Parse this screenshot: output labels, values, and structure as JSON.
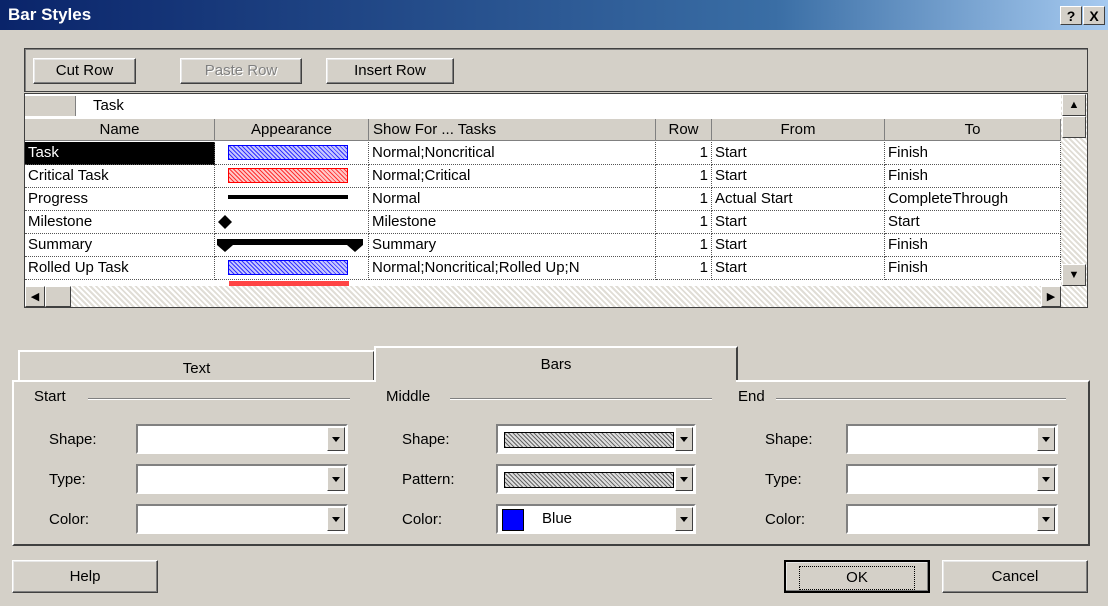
{
  "window": {
    "title": "Bar Styles",
    "help_btn": "?",
    "close_btn": "X"
  },
  "toolbar": {
    "cut_row": "Cut Row",
    "paste_row": "Paste Row",
    "insert_row": "Insert Row"
  },
  "grid": {
    "edit_value": "Task",
    "headers": [
      "Name",
      "Appearance",
      "Show For ... Tasks",
      "Row",
      "From",
      "To"
    ],
    "rows": [
      {
        "name": "Task",
        "appearance": "bar-blue",
        "show_for": "Normal;Noncritical",
        "row": "1",
        "from": "Start",
        "to": "Finish"
      },
      {
        "name": "Critical Task",
        "appearance": "bar-red",
        "show_for": "Normal;Critical",
        "row": "1",
        "from": "Start",
        "to": "Finish"
      },
      {
        "name": "Progress",
        "appearance": "thin-black-line",
        "show_for": "Normal",
        "row": "1",
        "from": "Actual Start",
        "to": "CompleteThrough"
      },
      {
        "name": "Milestone",
        "appearance": "diamond",
        "show_for": "Milestone",
        "row": "1",
        "from": "Start",
        "to": "Start"
      },
      {
        "name": "Summary",
        "appearance": "summary-bracket",
        "show_for": "Summary",
        "row": "1",
        "from": "Start",
        "to": "Finish"
      },
      {
        "name": "Rolled Up Task",
        "appearance": "bar-blue",
        "show_for": "Normal;Noncritical;Rolled Up;N",
        "row": "1",
        "from": "Start",
        "to": "Finish"
      }
    ]
  },
  "tabs": {
    "text": "Text",
    "bars": "Bars",
    "active": "Bars"
  },
  "groups": {
    "start": {
      "label": "Start",
      "shape_label": "Shape:",
      "type_label": "Type:",
      "color_label": "Color:",
      "shape": "",
      "type": "",
      "color": ""
    },
    "middle": {
      "label": "Middle",
      "shape_label": "Shape:",
      "pattern_label": "Pattern:",
      "color_label": "Color:",
      "color": "Blue"
    },
    "end": {
      "label": "End",
      "shape_label": "Shape:",
      "type_label": "Type:",
      "color_label": "Color:",
      "shape": "",
      "type": "",
      "color": ""
    }
  },
  "buttons": {
    "help": "Help",
    "ok": "OK",
    "cancel": "Cancel"
  },
  "colors": {
    "blue": "#0000ff",
    "red": "#ff0000",
    "title_start": "#0a246a",
    "face": "#d4d0c8"
  }
}
